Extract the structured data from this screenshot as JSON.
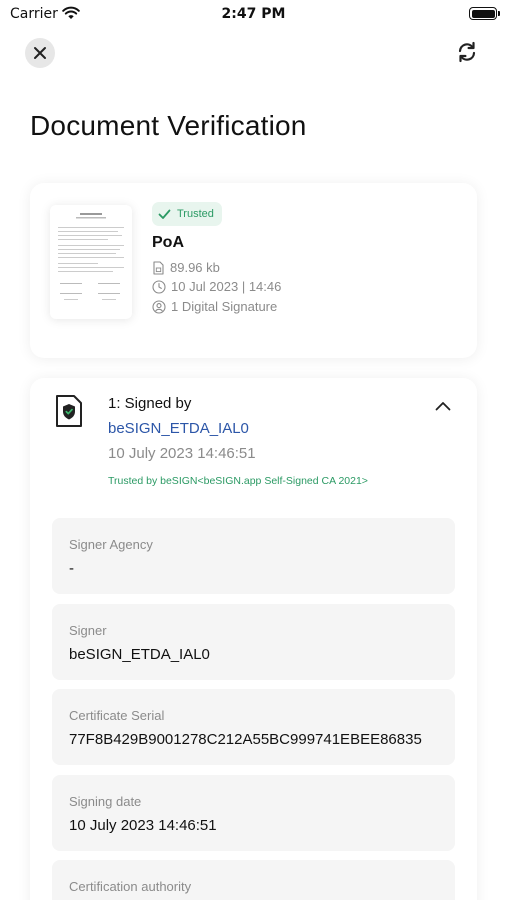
{
  "status_bar": {
    "carrier": "Carrier",
    "time": "2:47 PM"
  },
  "header": {
    "close_icon": "close-icon",
    "refresh_icon": "refresh-icon",
    "title": "Document Verification"
  },
  "document": {
    "badge_label": "Trusted",
    "name": "PoA",
    "size": "89.96 kb",
    "date": "10 Jul 2023 | 14:46",
    "signatures": "1 Digital Signature"
  },
  "signature": {
    "heading": "1: Signed by",
    "signer_name": "beSIGN_ETDA_IAL0",
    "signed_at": "10 July 2023 14:46:51",
    "trusted_by": "Trusted by beSIGN<beSIGN.app Self-Signed CA 2021>",
    "fields": [
      {
        "label": "Signer Agency",
        "value": "-"
      },
      {
        "label": "Signer",
        "value": "beSIGN_ETDA_IAL0"
      },
      {
        "label": "Certificate Serial",
        "value": "77F8B429B9001278C212A55BC999741EBEE86835"
      },
      {
        "label": "Signing date",
        "value": "10 July 2023 14:46:51"
      },
      {
        "label": "Certification authority",
        "value": ""
      }
    ]
  },
  "colors": {
    "accent_blue": "#2c56a8",
    "trusted_green": "#2b9a64",
    "trusted_bg": "#e8f5ee",
    "muted_text": "#8b8b8b",
    "field_bg": "#f5f5f5"
  }
}
